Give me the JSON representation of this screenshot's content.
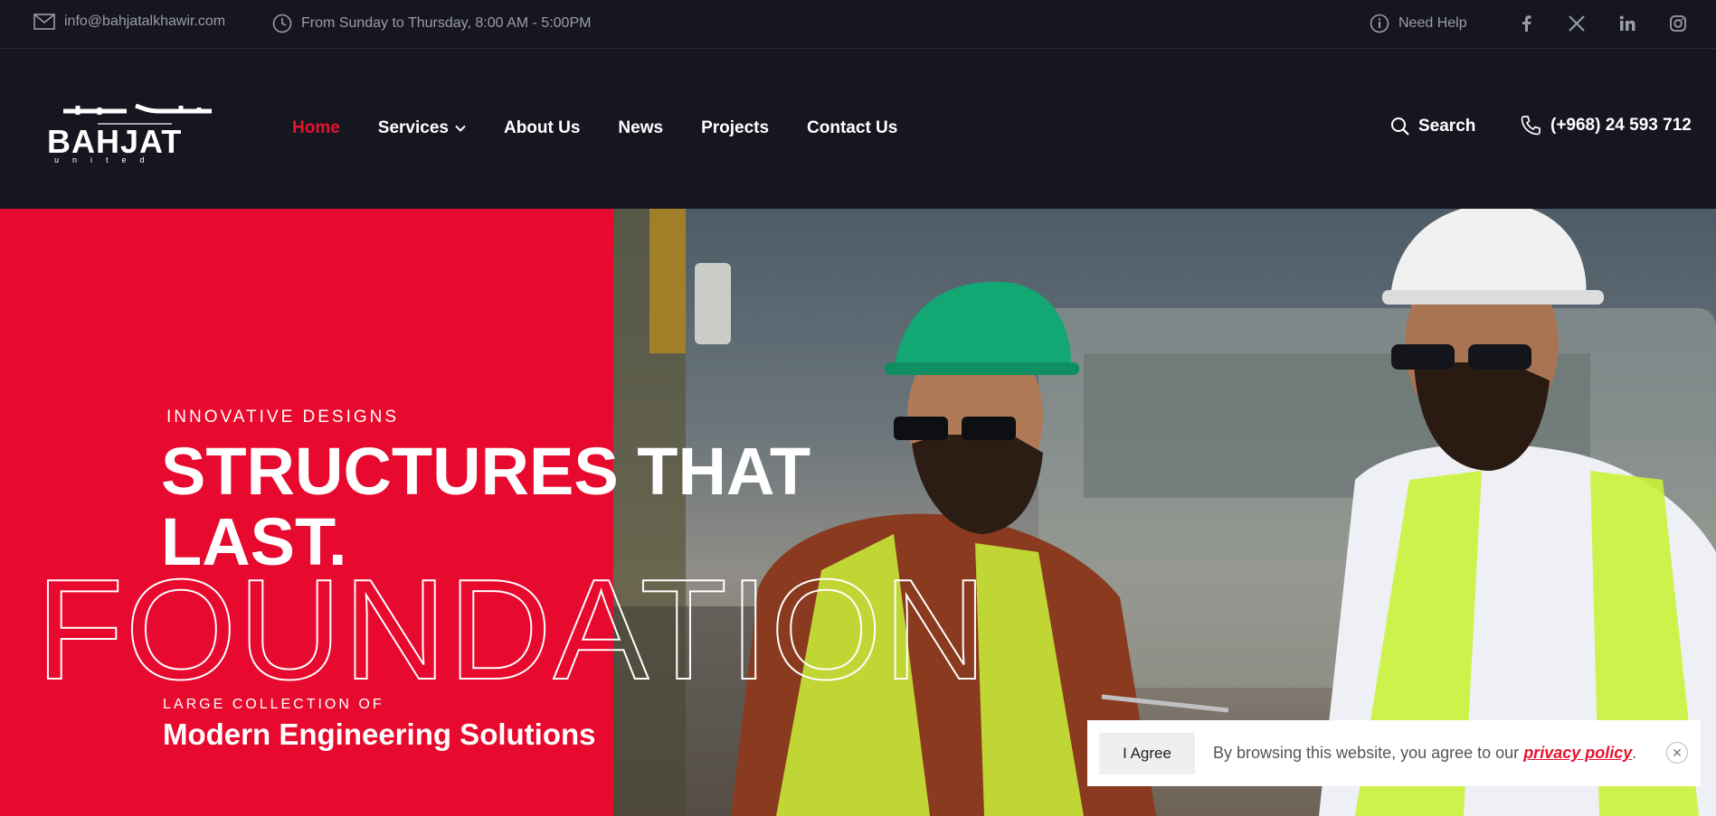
{
  "topbar": {
    "email": "info@bahjatalkhawir.com",
    "hours": "From Sunday to Thursday, 8:00 AM - 5:00PM",
    "help": "Need Help",
    "social": [
      "facebook-icon",
      "x-icon",
      "linkedin-icon",
      "instagram-icon"
    ]
  },
  "logo": {
    "text": "BAHJAT",
    "subtext": "united"
  },
  "nav": {
    "items": [
      {
        "label": "Home",
        "active": true
      },
      {
        "label": "Services",
        "dropdown": true
      },
      {
        "label": "About Us"
      },
      {
        "label": "News"
      },
      {
        "label": "Projects"
      },
      {
        "label": "Contact Us"
      }
    ],
    "search_label": "Search",
    "phone": "(+968) 24 593 712"
  },
  "hero": {
    "eyebrow": "INNOVATIVE DESIGNS",
    "headline": "STRUCTURES THAT LAST.",
    "outline_word": "FOUNDATION",
    "sub_eyebrow": "LARGE COLLECTION OF",
    "sub_title": "Modern Engineering Solutions"
  },
  "cookie": {
    "agree_label": "I Agree",
    "text": "By browsing this website, you agree to our ",
    "link": "privacy policy",
    "period": "."
  },
  "colors": {
    "accent": "#e8132d",
    "dark": "#151620",
    "hero_red": "#e8092e"
  }
}
